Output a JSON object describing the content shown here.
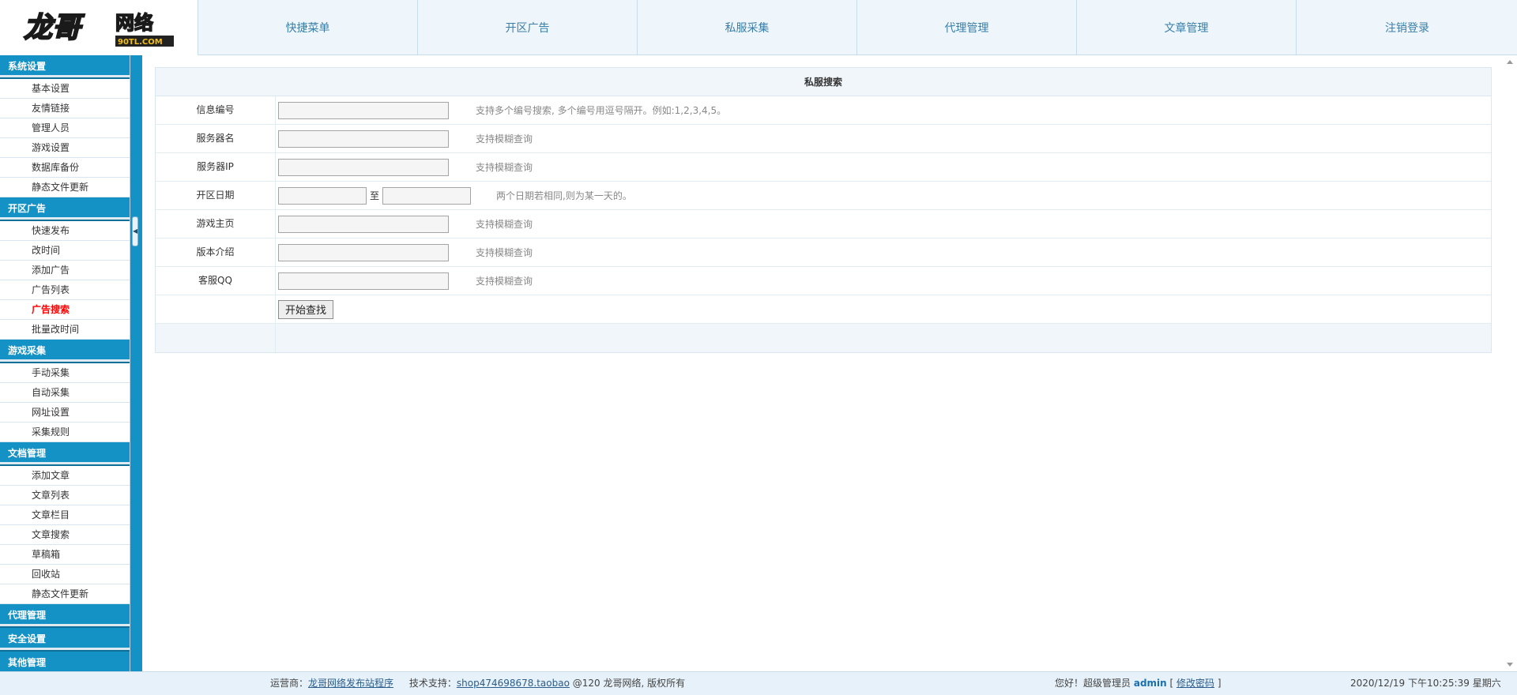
{
  "logo": {
    "main": "龙哥",
    "sub": "网络",
    "domain": "90TL.COM"
  },
  "nav": [
    "快捷菜单",
    "开区广告",
    "私服采集",
    "代理管理",
    "文章管理",
    "注销登录"
  ],
  "sidebar": [
    {
      "title": "系统设置",
      "items": [
        "基本设置",
        "友情链接",
        "管理人员",
        "游戏设置",
        "数据库备份",
        "静态文件更新"
      ]
    },
    {
      "title": "开区广告",
      "items": [
        "快速发布",
        "改时间",
        "添加广告",
        "广告列表",
        "广告搜索",
        "批量改时间"
      ],
      "active": "广告搜索"
    },
    {
      "title": "游戏采集",
      "items": [
        "手动采集",
        "自动采集",
        "网址设置",
        "采集规则"
      ]
    },
    {
      "title": "文档管理",
      "items": [
        "添加文章",
        "文章列表",
        "文章栏目",
        "文章搜索",
        "草稿箱",
        "回收站",
        "静态文件更新"
      ]
    },
    {
      "title": "代理管理",
      "items": []
    },
    {
      "title": "安全设置",
      "items": []
    },
    {
      "title": "其他管理",
      "items": []
    }
  ],
  "form": {
    "title": "私服搜索",
    "fields": {
      "id": {
        "label": "信息编号",
        "value": "",
        "hint": "支持多个编号搜索, 多个编号用逗号隔开。例如:1,2,3,4,5。"
      },
      "name": {
        "label": "服务器名",
        "value": "",
        "hint": "支持模糊查询"
      },
      "ip": {
        "label": "服务器IP",
        "value": "",
        "hint": "支持模糊查询"
      },
      "date": {
        "label": "开区日期",
        "from": "",
        "to": "",
        "separator": "至",
        "hint": "两个日期若相同,则为某一天的。"
      },
      "homepage": {
        "label": "游戏主页",
        "value": "",
        "hint": "支持模糊查询"
      },
      "version": {
        "label": "版本介绍",
        "value": "",
        "hint": "支持模糊查询"
      },
      "qq": {
        "label": "客服QQ",
        "value": "",
        "hint": "支持模糊查询"
      }
    },
    "submit_label": "开始查找"
  },
  "footer": {
    "operator_label": "运营商：",
    "operator_link": "龙哥网络发布站程序",
    "support_label": "技术支持：",
    "support_link": "shop474698678.taobao",
    "copyright": "@120 龙哥网络, 版权所有",
    "greeting": "您好！超级管理员",
    "admin": "admin",
    "bracket_open": "[",
    "change_password": "修改密码",
    "bracket_close": "]",
    "datetime": "2020/12/19 下午10:25:39 星期六"
  },
  "colors": {
    "accent": "#1592c5",
    "nav_text": "#3b7fa8",
    "active": "#ff0000"
  }
}
